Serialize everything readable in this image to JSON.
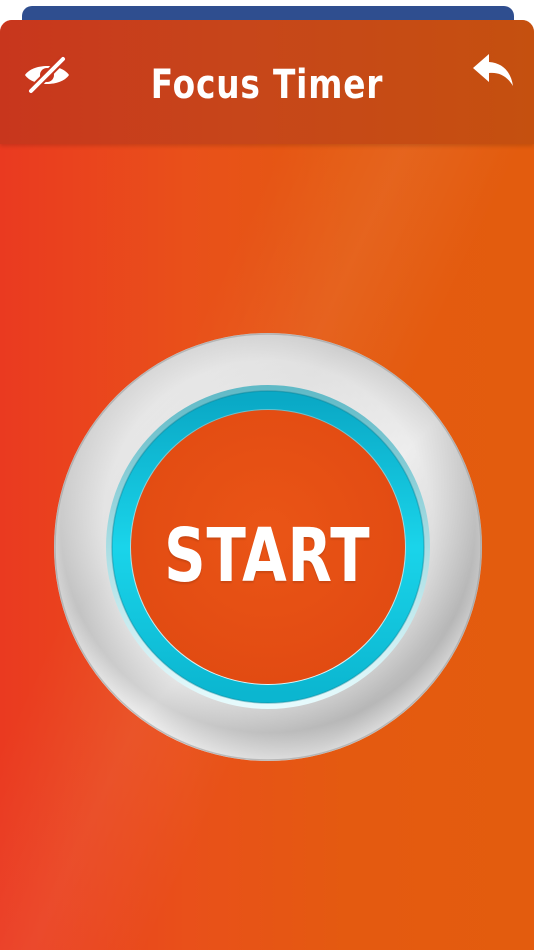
{
  "header": {
    "title": "Focus Timer",
    "left_icon": "eye-slash-icon",
    "right_icon": "reply-back-icon"
  },
  "main": {
    "start_button_label": "START"
  },
  "colors": {
    "background_left": "#ea3a20",
    "background_right": "#e35c0e",
    "header": "#c7461a",
    "ring_accent": "#12c8e0",
    "back_card": "#2f4e8f",
    "text": "#ffffff"
  }
}
